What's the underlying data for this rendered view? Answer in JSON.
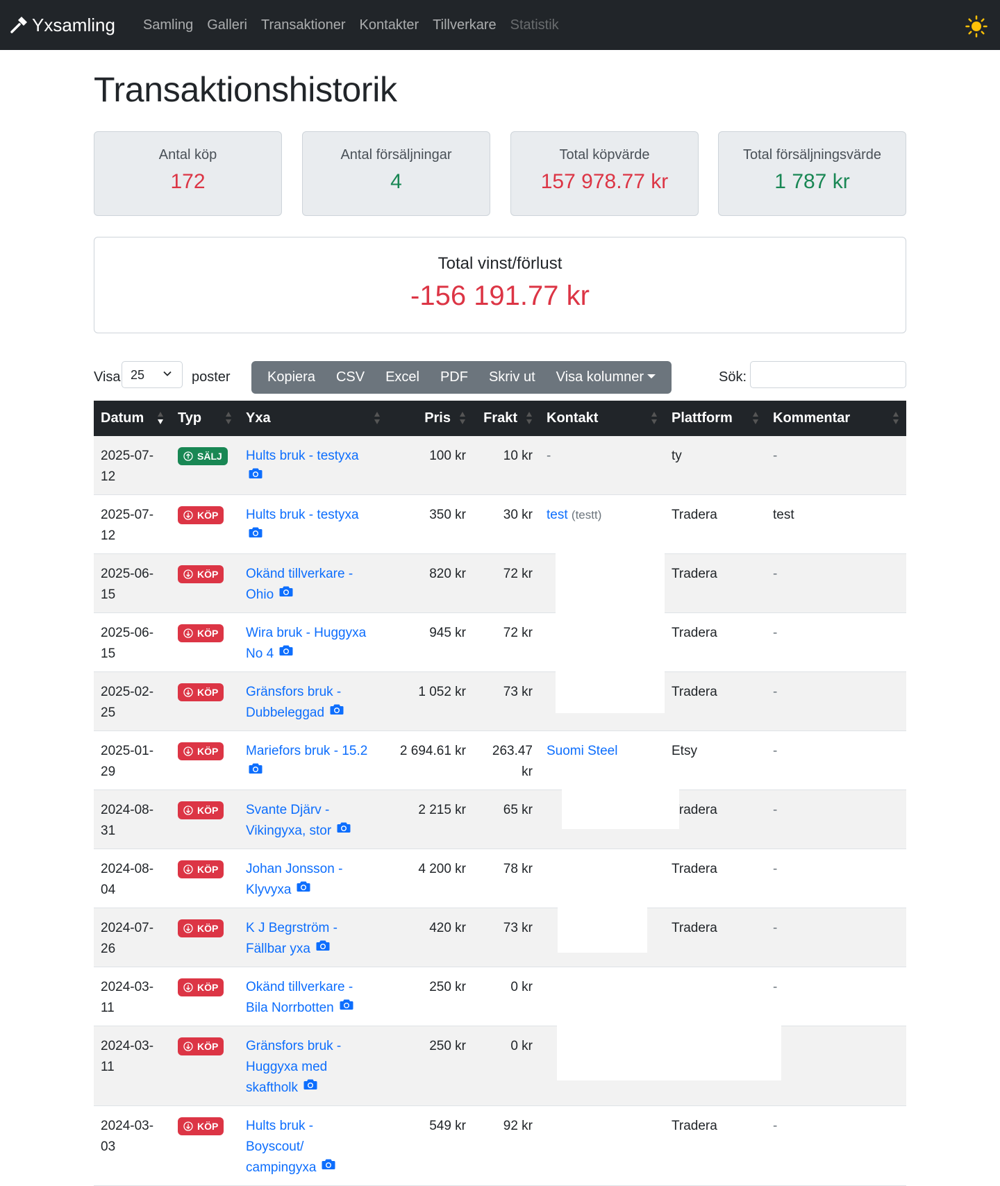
{
  "nav": {
    "brand": "Yxsamling",
    "links": [
      "Samling",
      "Galleri",
      "Transaktioner",
      "Kontakter",
      "Tillverkare",
      "Statistik"
    ],
    "sun_color": "#ffc107"
  },
  "page_title": "Transaktionshistorik",
  "stats": [
    {
      "label": "Antal köp",
      "value": "172",
      "color": "red"
    },
    {
      "label": "Antal försäljningar",
      "value": "4",
      "color": "green"
    },
    {
      "label": "Total köpvärde",
      "value": "157 978.77 kr",
      "color": "red"
    },
    {
      "label": "Total försäljningsvärde",
      "value": "1 787 kr",
      "color": "green"
    }
  ],
  "profit": {
    "label": "Total vinst/förlust",
    "value": "-156 191.77 kr"
  },
  "controls": {
    "show_label": "Visa",
    "page_size": "25",
    "entries_label": "poster",
    "buttons": [
      "Kopiera",
      "CSV",
      "Excel",
      "PDF",
      "Skriv ut",
      "Visa kolumner"
    ],
    "search_label": "Sök:",
    "search_value": ""
  },
  "table": {
    "headers": [
      "Datum",
      "Typ",
      "Yxa",
      "Pris",
      "Frakt",
      "Kontakt",
      "Plattform",
      "Kommentar"
    ],
    "rows": [
      {
        "date": "2025-07-12",
        "type": "SÄLJ",
        "axe": [
          "Hults bruk - testyxa"
        ],
        "price": "100 kr",
        "shipping": "10 kr",
        "contact": "-",
        "platform": "ty",
        "comment": "-"
      },
      {
        "date": "2025-07-12",
        "type": "KÖP",
        "axe": [
          "Hults bruk - testyxa"
        ],
        "price": "350 kr",
        "shipping": "30 kr",
        "contact": "test",
        "contact_alias": "(testt)",
        "platform": "Tradera",
        "comment": "test"
      },
      {
        "date": "2025-06-15",
        "type": "KÖP",
        "axe": [
          "Okänd tillverkare -",
          "Ohio"
        ],
        "price": "820 kr",
        "shipping": "72 kr",
        "contact": "",
        "platform": "Tradera",
        "comment": "-"
      },
      {
        "date": "2025-06-15",
        "type": "KÖP",
        "axe": [
          "Wira bruk - Huggyxa",
          "No 4"
        ],
        "price": "945 kr",
        "shipping": "72 kr",
        "contact": "",
        "platform": "Tradera",
        "comment": "-"
      },
      {
        "date": "2025-02-25",
        "type": "KÖP",
        "axe": [
          "Gränsfors bruk -",
          "Dubbeleggad"
        ],
        "price": "1 052 kr",
        "shipping": "73 kr",
        "contact": "",
        "platform": "Tradera",
        "comment": "-"
      },
      {
        "date": "2025-01-29",
        "type": "KÖP",
        "axe": [
          "Mariefors bruk - 15.2"
        ],
        "price": "2 694.61 kr",
        "shipping": "263.47 kr",
        "contact": "Suomi Steel",
        "platform": "Etsy",
        "comment": "-"
      },
      {
        "date": "2024-08-31",
        "type": "KÖP",
        "axe": [
          "Svante Djärv -",
          "Vikingyxa, stor"
        ],
        "price": "2 215 kr",
        "shipping": "65 kr",
        "contact": "",
        "platform": "Tradera",
        "comment": "-"
      },
      {
        "date": "2024-08-04",
        "type": "KÖP",
        "axe": [
          "Johan Jonsson -",
          "Klyvyxa"
        ],
        "price": "4 200 kr",
        "shipping": "78 kr",
        "contact": "",
        "platform": "Tradera",
        "comment": "-"
      },
      {
        "date": "2024-07-26",
        "type": "KÖP",
        "axe": [
          "K J Begrström -",
          "Fällbar yxa"
        ],
        "price": "420 kr",
        "shipping": "73 kr",
        "contact": "",
        "platform": "Tradera",
        "comment": "-"
      },
      {
        "date": "2024-03-11",
        "type": "KÖP",
        "axe": [
          "Okänd tillverkare -",
          "Bila Norrbotten"
        ],
        "price": "250 kr",
        "shipping": "0 kr",
        "contact": "",
        "platform": "",
        "comment": "-"
      },
      {
        "date": "2024-03-11",
        "type": "KÖP",
        "axe": [
          "Gränsfors bruk -",
          "Huggyxa med",
          "skaftholk"
        ],
        "price": "250 kr",
        "shipping": "0 kr",
        "contact": "",
        "platform": "",
        "comment": "-"
      },
      {
        "date": "2024-03-03",
        "type": "KÖP",
        "axe": [
          "Hults bruk -",
          "Boyscout/",
          "campingyxa"
        ],
        "price": "549 kr",
        "shipping": "92 kr",
        "contact": "",
        "platform": "Tradera",
        "comment": "-"
      }
    ]
  },
  "colors": {
    "navbar": "#212529",
    "link": "#0d6efd",
    "red": "#dc3545",
    "green": "#198754",
    "btn_group": "#6c757d"
  }
}
